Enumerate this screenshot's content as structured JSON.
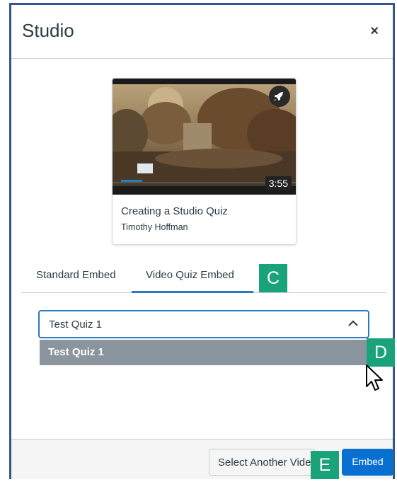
{
  "dialog": {
    "title": "Studio",
    "close_icon": "×"
  },
  "video_card": {
    "title": "Creating a Studio Quiz",
    "author": "Timothy Hoffman",
    "duration": "3:55"
  },
  "tabs": {
    "standard": "Standard Embed",
    "quiz": "Video Quiz Embed",
    "active": "Video Quiz Embed"
  },
  "quiz_select": {
    "value": "Test Quiz 1",
    "options": [
      "Test Quiz 1"
    ]
  },
  "footer": {
    "select_another": "Select Another Video",
    "embed": "Embed"
  },
  "callouts": {
    "c": "C",
    "d": "D",
    "e": "E"
  },
  "colors": {
    "frame": "#35568a",
    "accent": "#2b7abc",
    "primary": "#0770d1",
    "callout": "#1aa37a",
    "option_highlight": "#8b959e"
  }
}
